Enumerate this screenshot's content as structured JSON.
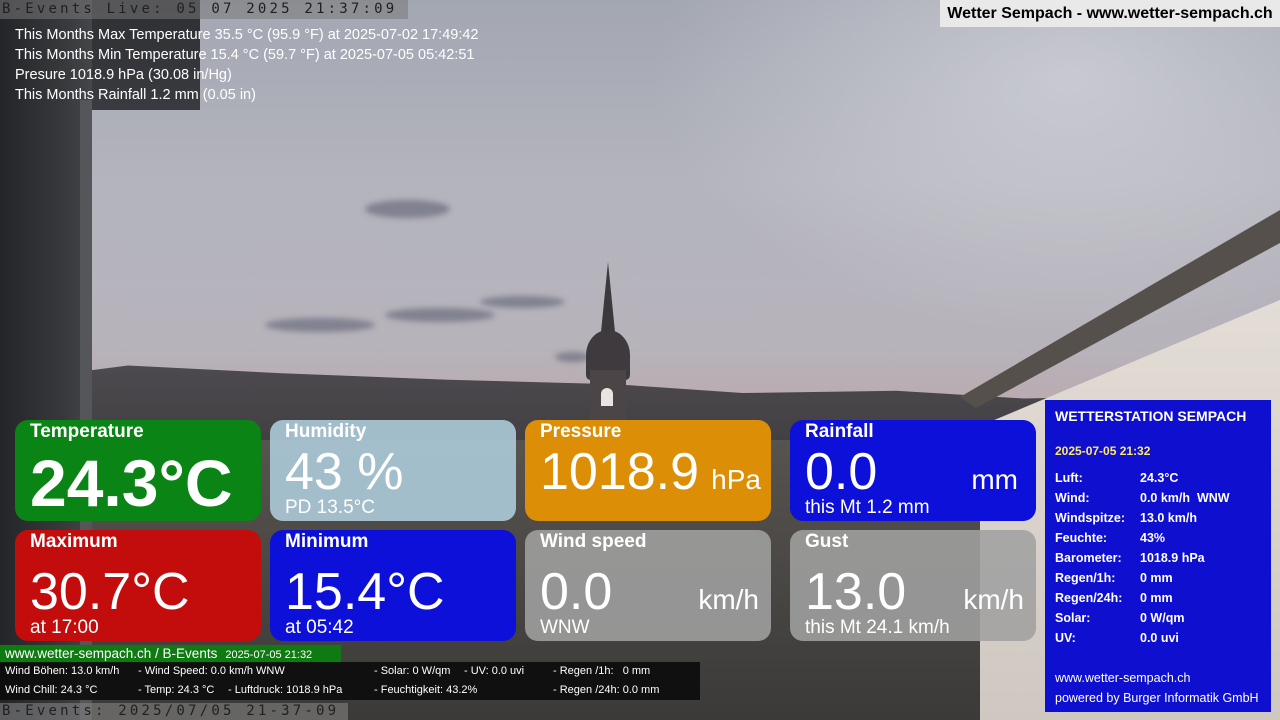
{
  "top_bar": {
    "live_stamp": "B-Events Live: 05 07 2025 21:37:09",
    "site_title": "Wetter Sempach - www.wetter-sempach.ch"
  },
  "month_stats": [
    "This Months Max Temperature 35.5 °C (95.9 °F) at 2025-07-02 17:49:42",
    "This Months Min Temperature 15.4 °C (59.7 °F) at 2025-07-05 05:42:51",
    "Presure 1018.9 hPa (30.08 in/Hg)",
    "This Months Rainfall 1.2 mm (0.05 in)"
  ],
  "tiles": {
    "temperature": {
      "title": "Temperature",
      "value": "24.3°C",
      "color": "#0a8415"
    },
    "humidity": {
      "title": "Humidity",
      "value": "43 %",
      "sub": "PD 13.5°C",
      "color": "#aac8d6"
    },
    "pressure": {
      "title": "Pressure",
      "value": "1018.9",
      "unit": "hPa",
      "color": "#dc8f06"
    },
    "rainfall": {
      "title": "Rainfall",
      "value": "0.0",
      "unit": "mm",
      "sub": "this Mt 1.2 mm",
      "color": "#0d10d8"
    },
    "maximum": {
      "title": "Maximum",
      "value": "30.7°C",
      "sub": "at 17:00",
      "color": "#c30d0d"
    },
    "minimum": {
      "title": "Minimum",
      "value": "15.4°C",
      "sub": "at 05:42",
      "color": "#0d10d8"
    },
    "wind_speed": {
      "title": "Wind speed",
      "value": "0.0",
      "unit": "km/h",
      "sub": "WNW",
      "color": "#a0a0a0"
    },
    "gust": {
      "title": "Gust",
      "value": "13.0",
      "unit": "km/h",
      "sub": "this Mt 24.1 km/h",
      "color": "#a0a0a0"
    }
  },
  "station": {
    "title": "WETTERSTATION SEMPACH",
    "date": "2025-07-05 21:32",
    "rows": [
      {
        "key": "Luft:",
        "value": "24.3°C"
      },
      {
        "key": "Wind:",
        "value": "0.0 km/h  WNW"
      },
      {
        "key": "Windspitze:",
        "value": "13.0 km/h"
      },
      {
        "key": "Feuchte:",
        "value": "43%"
      },
      {
        "key": "Barometer:",
        "value": "1018.9 hPa"
      },
      {
        "key": "Regen/1h:",
        "value": "0 mm"
      },
      {
        "key": "Regen/24h:",
        "value": "0 mm"
      },
      {
        "key": "Solar:",
        "value": "0 W/qm"
      },
      {
        "key": "UV:",
        "value": "0.0 uvi"
      }
    ],
    "footer_url": "www.wetter-sempach.ch",
    "footer_credit": "powered by Burger Informatik GmbH",
    "color": "#0f10cf"
  },
  "ticker": {
    "head": "www.wetter-sempach.ch / B-Events",
    "head_date": "2025-07-05 21:32",
    "line1": {
      "a": "Wind Böhen: 13.0 km/h",
      "b": "- Wind Speed: 0.0 km/h WNW",
      "c": "- Solar: 0 W/qm",
      "d": "- UV: 0.0 uvi",
      "e": "- Regen /1h:   0 mm"
    },
    "line2": {
      "a": "Wind Chill: 24.3 °C",
      "b": "- Temp: 24.3 °C",
      "c": "- Luftdruck: 1018.9 hPa",
      "d": "- Feuchtigkeit: 43.2%",
      "e": "- Regen /24h: 0.0 mm"
    }
  },
  "bottom_stamp": "B-Events: 2025/07/05 21-37-09"
}
